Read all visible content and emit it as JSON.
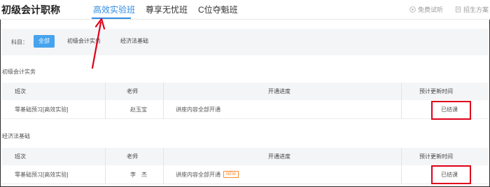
{
  "header": {
    "brand": "初级会计职称",
    "tabs": [
      {
        "label": "高效实验班",
        "active": true
      },
      {
        "label": "尊享无忧班",
        "active": false
      },
      {
        "label": "C位夺魁班",
        "active": false
      }
    ],
    "links": [
      {
        "label": "免费试听",
        "icon": "play-circle-icon"
      },
      {
        "label": "招生方案",
        "icon": "document-icon"
      }
    ]
  },
  "filter": {
    "label": "科目：",
    "chips": [
      {
        "label": "全部",
        "active": true
      },
      {
        "label": "初级会计实务",
        "active": false
      },
      {
        "label": "经济法基础",
        "active": false
      }
    ]
  },
  "sections": [
    {
      "title": "初级会计实务",
      "columns": [
        "班次",
        "老师",
        "开通进度",
        "预计更新时间"
      ],
      "rows": [
        {
          "class_name": "零基础预习[高效实验]",
          "teacher": "赵玉宝",
          "progress": "讲座内容全部开通",
          "is_new": false,
          "update_time": "已结课"
        }
      ]
    },
    {
      "title": "经济法基础",
      "columns": [
        "班次",
        "老师",
        "开通进度",
        "预计更新时间"
      ],
      "rows": [
        {
          "class_name": "零基础预习[高效实验]",
          "teacher": "李　杰",
          "progress": "讲座内容全部开通",
          "is_new": true,
          "badge": "NEW",
          "update_time": "已结课"
        }
      ]
    }
  ],
  "colors": {
    "accent": "#2f8ce3",
    "chip_active": "#46a3ee",
    "annotation_red": "#e0001a",
    "badge_orange": "#ff8a2a"
  }
}
